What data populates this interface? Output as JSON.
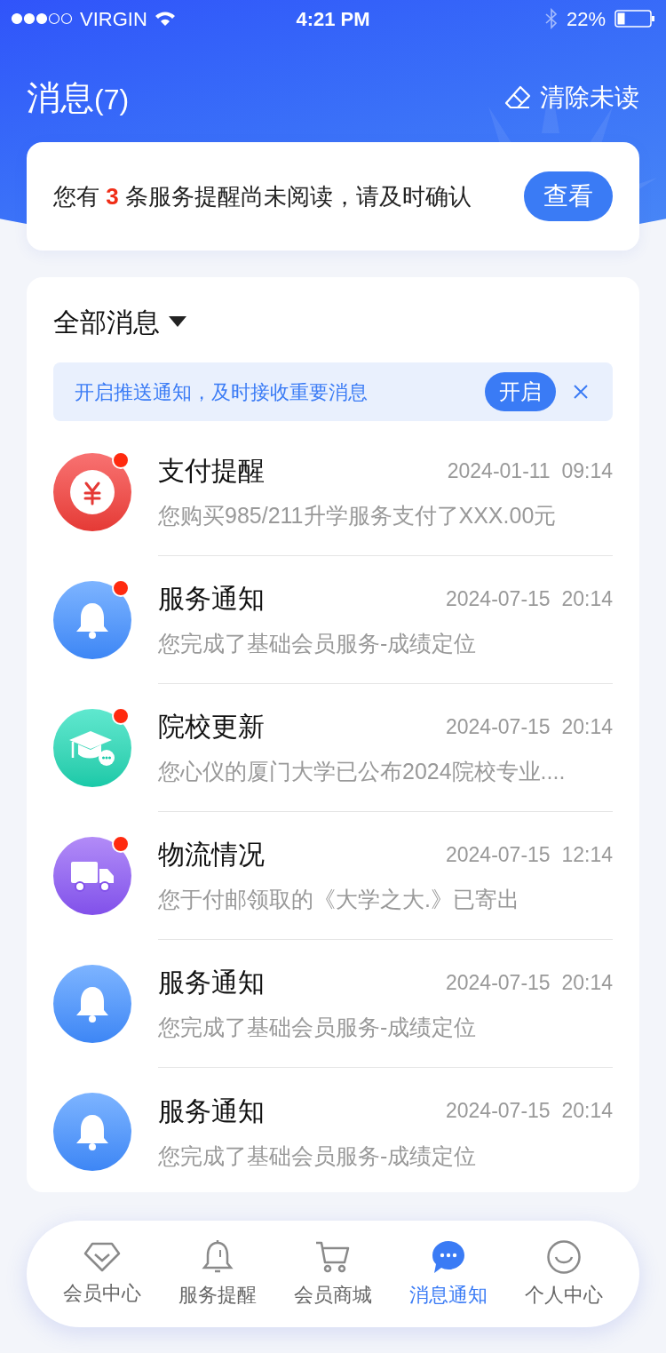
{
  "status_bar": {
    "carrier": "VIRGIN",
    "time": "4:21 PM",
    "battery": "22%"
  },
  "header": {
    "title": "消息",
    "count": "(7)",
    "clear_action": "清除未读"
  },
  "summary": {
    "before": "您有",
    "count": "3",
    "after": "条服务提醒尚未阅读，请及时确认",
    "button": "查看"
  },
  "messages": {
    "filter": "全部消息",
    "push_banner": {
      "text": "开启推送通知，及时接收重要消息",
      "button": "开启"
    },
    "items": [
      {
        "kind": "payment",
        "title": "支付提醒",
        "time": "2024-01-11  09:14",
        "body": "您购买985/211升学服务支付了XXX.00元",
        "unread": true
      },
      {
        "kind": "service",
        "title": "服务通知",
        "time": "2024-07-15  20:14",
        "body": "您完成了基础会员服务-成绩定位",
        "unread": true
      },
      {
        "kind": "school",
        "title": "院校更新",
        "time": "2024-07-15  20:14",
        "body": "您心仪的厦门大学已公布2024院校专业....",
        "unread": true
      },
      {
        "kind": "logistics",
        "title": "物流情况",
        "time": "2024-07-15  12:14",
        "body": "您于付邮领取的《大学之大.》已寄出",
        "unread": true
      },
      {
        "kind": "service",
        "title": "服务通知",
        "time": "2024-07-15  20:14",
        "body": "您完成了基础会员服务-成绩定位",
        "unread": false
      },
      {
        "kind": "service",
        "title": "服务通知",
        "time": "2024-07-15  20:14",
        "body": "您完成了基础会员服务-成绩定位",
        "unread": false
      }
    ]
  },
  "tab_bar": [
    {
      "kind": "vip",
      "label": "会员中心",
      "selected": false
    },
    {
      "kind": "bell",
      "label": "服务提醒",
      "selected": false
    },
    {
      "kind": "cart",
      "label": "会员商城",
      "selected": false
    },
    {
      "kind": "chat",
      "label": "消息通知",
      "selected": true
    },
    {
      "kind": "person",
      "label": "个人中心",
      "selected": false
    }
  ]
}
